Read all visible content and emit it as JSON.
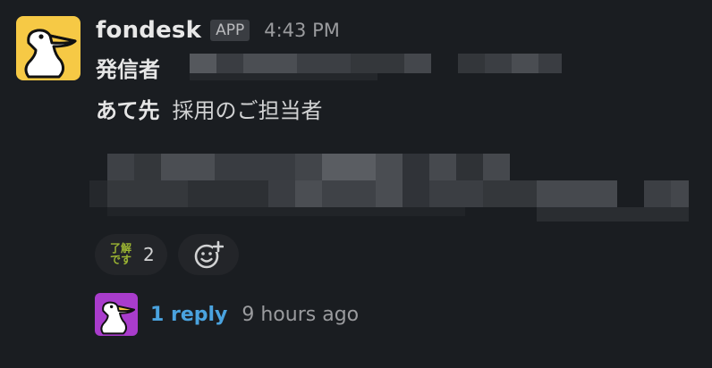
{
  "message": {
    "app_name": "fondesk",
    "app_badge": "APP",
    "time": "4:43 PM",
    "sender_label": "発信者",
    "recipient_label": "あて先",
    "recipient_value": "採用のご担当者"
  },
  "reactions": [
    {
      "emoji_text": "了解\nです",
      "count": "2"
    }
  ],
  "thread": {
    "reply_count": "1 reply",
    "last_reply": "9 hours ago"
  },
  "icons": {
    "avatar": "pelican-logo",
    "add_reaction": "add-reaction-icon",
    "thread_avatar": "pelican-logo"
  },
  "colors": {
    "background": "#1a1d21",
    "avatar_bg": "#f6c945",
    "thread_avatar_bg": "#a93ccc",
    "link": "#4aa3df"
  }
}
